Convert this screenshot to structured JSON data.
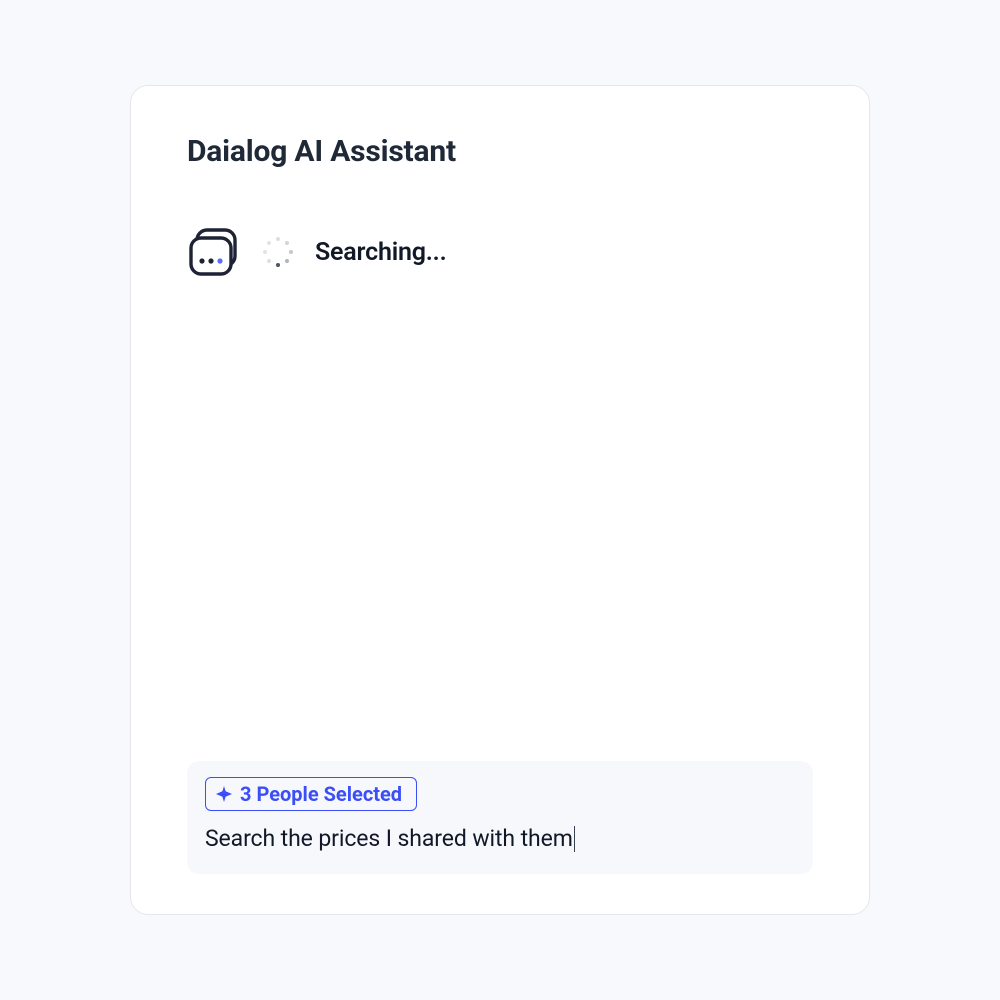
{
  "header": {
    "title": "Daialog AI Assistant"
  },
  "status": {
    "label": "Searching...",
    "icon": "messages-stack-icon",
    "spinner": "spinner-icon"
  },
  "composer": {
    "chip": {
      "icon": "sparkle-icon",
      "label": "3 People Selected"
    },
    "input": {
      "value": "Search the prices I shared with them"
    }
  },
  "colors": {
    "accent": "#3b4ef8",
    "text": "#111827",
    "muted": "#9ca3af",
    "card_bg": "#ffffff",
    "page_bg": "#f8f9fc",
    "composer_bg": "#f7f8fc"
  }
}
